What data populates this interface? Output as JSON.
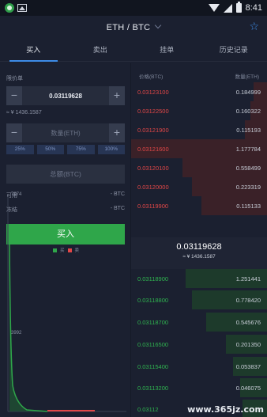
{
  "status_bar": {
    "time": "8:41"
  },
  "header": {
    "pair": "ETH / BTC"
  },
  "tabs": [
    "买入",
    "卖出",
    "挂单",
    "历史记录"
  ],
  "form": {
    "price_label": "限价单",
    "price_value": "0.03119628",
    "rmb_equiv": "≈ ¥ 1436.1587",
    "amount_placeholder": "数量(ETH)",
    "percents": [
      "25%",
      "50%",
      "75%",
      "100%"
    ],
    "total_label": "总额(BTC)",
    "available_label": "可用",
    "available_value": "- BTC",
    "frozen_label": "冻结",
    "frozen_value": "- BTC",
    "buy_label": "买入"
  },
  "depth": {
    "legend": [
      "买",
      "卖"
    ],
    "y_top": "7974",
    "y_mid": "3992",
    "colors": {
      "bid": "#2fa64a",
      "ask": "#e24747"
    }
  },
  "orderbook": {
    "price_header": "价格(BTC)",
    "qty_header": "数量(ETH)",
    "asks": [
      {
        "price": "0.03123100",
        "qty": "0.184999"
      },
      {
        "price": "0.03122500",
        "qty": "0.160322"
      },
      {
        "price": "0.03121900",
        "qty": "0.115193"
      },
      {
        "price": "0.03121600",
        "qty": "1.177784"
      },
      {
        "price": "0.03120100",
        "qty": "0.558499"
      },
      {
        "price": "0.03120000",
        "qty": "0.223319"
      },
      {
        "price": "0.03119900",
        "qty": "0.115133"
      }
    ],
    "last_price": "0.03119628",
    "last_rmb": "≈ ¥ 1436.1587",
    "bids": [
      {
        "price": "0.03118900",
        "qty": "1.251441"
      },
      {
        "price": "0.03118800",
        "qty": "0.778420"
      },
      {
        "price": "0.03118700",
        "qty": "0.545676"
      },
      {
        "price": "0.03116500",
        "qty": "0.201350"
      },
      {
        "price": "0.03115400",
        "qty": "0.053837"
      },
      {
        "price": "0.03113200",
        "qty": "0.046075"
      },
      {
        "price": "0.03112",
        "qty": ""
      }
    ]
  },
  "watermark": "www.365jz.com"
}
